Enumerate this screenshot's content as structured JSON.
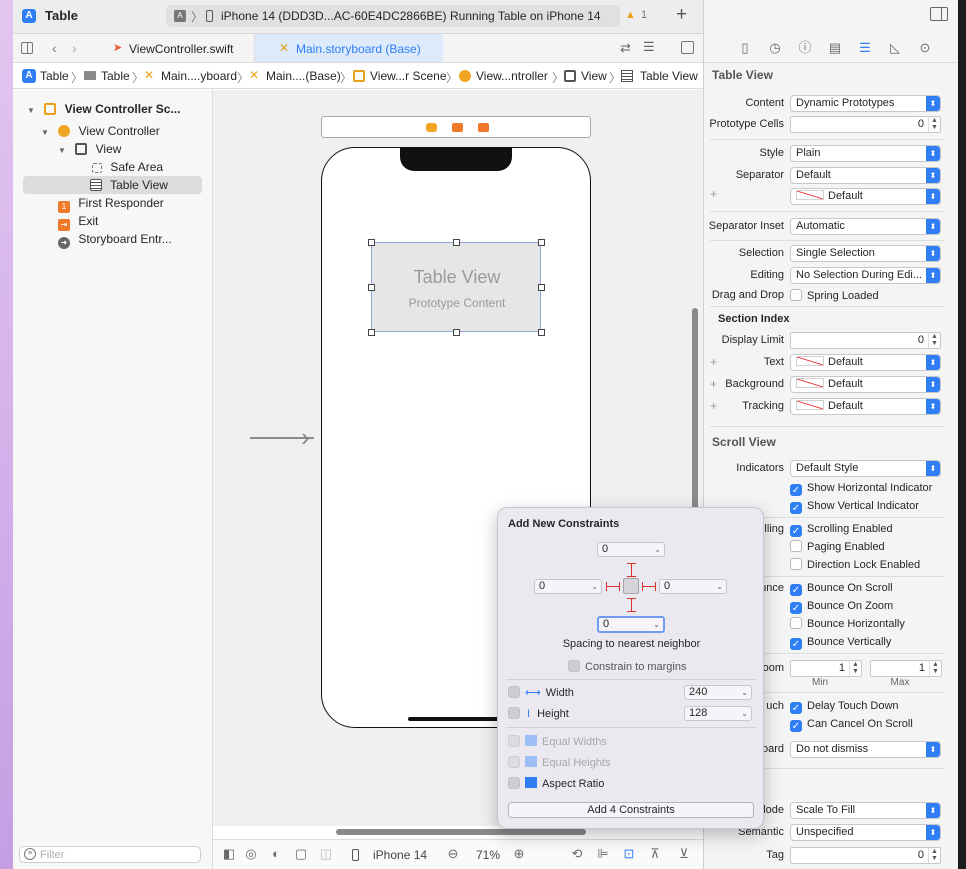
{
  "titlebar": {
    "app_title": "Table",
    "scheme_device": "iPhone 14 (DDD3D...AC-60E4DC2866BE)",
    "status": "Running Table on iPhone 14",
    "warning_count": "1"
  },
  "tabs": [
    {
      "label": "ViewController.swift"
    },
    {
      "label": "Main.storyboard (Base)"
    }
  ],
  "breadcrumb": [
    "Table",
    "Table",
    "Main....yboard",
    "Main....(Base)",
    "View...r Scene",
    "View...ntroller",
    "View",
    "Table View"
  ],
  "navigator": {
    "items": [
      {
        "label": "View Controller Sc..."
      },
      {
        "label": "View Controller"
      },
      {
        "label": "View"
      },
      {
        "label": "Safe Area"
      },
      {
        "label": "Table View"
      },
      {
        "label": "First Responder"
      },
      {
        "label": "Exit"
      },
      {
        "label": "Storyboard Entr..."
      }
    ],
    "filter_placeholder": "Filter"
  },
  "canvas": {
    "tableview_title": "Table View",
    "tableview_subtitle": "Prototype Content",
    "device": "iPhone 14",
    "zoom": "71%"
  },
  "inspector": {
    "table_view_header": "Table View",
    "content_label": "Content",
    "content_value": "Dynamic Prototypes",
    "prototype_cells_label": "Prototype Cells",
    "prototype_cells_value": "0",
    "style_label": "Style",
    "style_value": "Plain",
    "separator_label": "Separator",
    "separator_value": "Default",
    "separator_color_value": "Default",
    "separator_inset_label": "Separator Inset",
    "separator_inset_value": "Automatic",
    "selection_label": "Selection",
    "selection_value": "Single Selection",
    "editing_label": "Editing",
    "editing_value": "No Selection During Edi...",
    "drag_drop_label": "Drag and Drop",
    "spring_loaded": "Spring Loaded",
    "section_index_header": "Section Index",
    "display_limit_label": "Display Limit",
    "display_limit_value": "0",
    "text_label": "Text",
    "text_value": "Default",
    "background_label": "Background",
    "background_value": "Default",
    "tracking_label": "Tracking",
    "tracking_value": "Default",
    "scroll_view_header": "Scroll View",
    "indicators_label": "Indicators",
    "indicators_value": "Default Style",
    "show_h": "Show Horizontal Indicator",
    "show_v": "Show Vertical Indicator",
    "scrolling_label_partial": "lling",
    "scrolling_enabled": "Scrolling Enabled",
    "paging_enabled": "Paging Enabled",
    "direction_lock": "Direction Lock Enabled",
    "bounce_label_partial": "unce",
    "bounce_scroll": "Bounce On Scroll",
    "bounce_zoom": "Bounce On Zoom",
    "bounce_h": "Bounce Horizontally",
    "bounce_v": "Bounce Vertically",
    "zoom_label_partial": "oom",
    "zoom_min_value": "1",
    "zoom_max_value": "1",
    "min_label": "Min",
    "max_label": "Max",
    "touch_label_partial": "uch",
    "delay_touch": "Delay Touch Down",
    "cancel_scroll": "Can Cancel On Scroll",
    "keyboard_label_partial": "oard",
    "keyboard_value": "Do not dismiss",
    "mode_label_partial": "lode",
    "mode_value": "Scale To Fill",
    "semantic_label": "Semantic",
    "semantic_value": "Unspecified",
    "tag_label": "Tag",
    "tag_value": "0"
  },
  "popover": {
    "title": "Add New Constraints",
    "top_value": "0",
    "leading_value": "0",
    "trailing_value": "0",
    "bottom_value": "0",
    "spacing_label": "Spacing to nearest neighbor",
    "constrain_margins": "Constrain to margins",
    "width_label": "Width",
    "width_value": "240",
    "height_label": "Height",
    "height_value": "128",
    "equal_widths": "Equal Widths",
    "equal_heights": "Equal Heights",
    "aspect_ratio": "Aspect Ratio",
    "add_button": "Add 4 Constraints"
  },
  "colors": {
    "accent": "#2f7ef6",
    "constraint_red": "#d9322e",
    "selection": "#dcdcdc"
  }
}
